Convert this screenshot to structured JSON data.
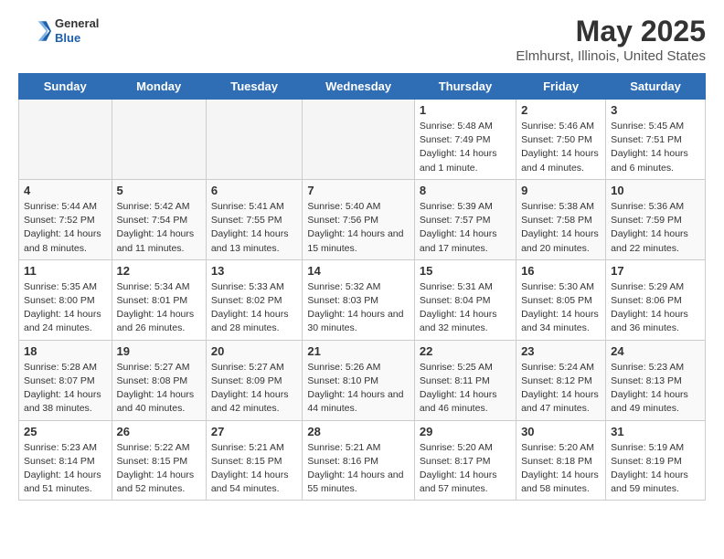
{
  "logo": {
    "general": "General",
    "blue": "Blue"
  },
  "title": "May 2025",
  "subtitle": "Elmhurst, Illinois, United States",
  "days_of_week": [
    "Sunday",
    "Monday",
    "Tuesday",
    "Wednesday",
    "Thursday",
    "Friday",
    "Saturday"
  ],
  "weeks": [
    [
      {
        "day": "",
        "empty": true
      },
      {
        "day": "",
        "empty": true
      },
      {
        "day": "",
        "empty": true
      },
      {
        "day": "",
        "empty": true
      },
      {
        "day": "1",
        "info": "Sunrise: 5:48 AM\nSunset: 7:49 PM\nDaylight: 14 hours\nand 1 minute."
      },
      {
        "day": "2",
        "info": "Sunrise: 5:46 AM\nSunset: 7:50 PM\nDaylight: 14 hours\nand 4 minutes."
      },
      {
        "day": "3",
        "info": "Sunrise: 5:45 AM\nSunset: 7:51 PM\nDaylight: 14 hours\nand 6 minutes."
      }
    ],
    [
      {
        "day": "4",
        "info": "Sunrise: 5:44 AM\nSunset: 7:52 PM\nDaylight: 14 hours\nand 8 minutes."
      },
      {
        "day": "5",
        "info": "Sunrise: 5:42 AM\nSunset: 7:54 PM\nDaylight: 14 hours\nand 11 minutes."
      },
      {
        "day": "6",
        "info": "Sunrise: 5:41 AM\nSunset: 7:55 PM\nDaylight: 14 hours\nand 13 minutes."
      },
      {
        "day": "7",
        "info": "Sunrise: 5:40 AM\nSunset: 7:56 PM\nDaylight: 14 hours\nand 15 minutes."
      },
      {
        "day": "8",
        "info": "Sunrise: 5:39 AM\nSunset: 7:57 PM\nDaylight: 14 hours\nand 17 minutes."
      },
      {
        "day": "9",
        "info": "Sunrise: 5:38 AM\nSunset: 7:58 PM\nDaylight: 14 hours\nand 20 minutes."
      },
      {
        "day": "10",
        "info": "Sunrise: 5:36 AM\nSunset: 7:59 PM\nDaylight: 14 hours\nand 22 minutes."
      }
    ],
    [
      {
        "day": "11",
        "info": "Sunrise: 5:35 AM\nSunset: 8:00 PM\nDaylight: 14 hours\nand 24 minutes."
      },
      {
        "day": "12",
        "info": "Sunrise: 5:34 AM\nSunset: 8:01 PM\nDaylight: 14 hours\nand 26 minutes."
      },
      {
        "day": "13",
        "info": "Sunrise: 5:33 AM\nSunset: 8:02 PM\nDaylight: 14 hours\nand 28 minutes."
      },
      {
        "day": "14",
        "info": "Sunrise: 5:32 AM\nSunset: 8:03 PM\nDaylight: 14 hours\nand 30 minutes."
      },
      {
        "day": "15",
        "info": "Sunrise: 5:31 AM\nSunset: 8:04 PM\nDaylight: 14 hours\nand 32 minutes."
      },
      {
        "day": "16",
        "info": "Sunrise: 5:30 AM\nSunset: 8:05 PM\nDaylight: 14 hours\nand 34 minutes."
      },
      {
        "day": "17",
        "info": "Sunrise: 5:29 AM\nSunset: 8:06 PM\nDaylight: 14 hours\nand 36 minutes."
      }
    ],
    [
      {
        "day": "18",
        "info": "Sunrise: 5:28 AM\nSunset: 8:07 PM\nDaylight: 14 hours\nand 38 minutes."
      },
      {
        "day": "19",
        "info": "Sunrise: 5:27 AM\nSunset: 8:08 PM\nDaylight: 14 hours\nand 40 minutes."
      },
      {
        "day": "20",
        "info": "Sunrise: 5:27 AM\nSunset: 8:09 PM\nDaylight: 14 hours\nand 42 minutes."
      },
      {
        "day": "21",
        "info": "Sunrise: 5:26 AM\nSunset: 8:10 PM\nDaylight: 14 hours\nand 44 minutes."
      },
      {
        "day": "22",
        "info": "Sunrise: 5:25 AM\nSunset: 8:11 PM\nDaylight: 14 hours\nand 46 minutes."
      },
      {
        "day": "23",
        "info": "Sunrise: 5:24 AM\nSunset: 8:12 PM\nDaylight: 14 hours\nand 47 minutes."
      },
      {
        "day": "24",
        "info": "Sunrise: 5:23 AM\nSunset: 8:13 PM\nDaylight: 14 hours\nand 49 minutes."
      }
    ],
    [
      {
        "day": "25",
        "info": "Sunrise: 5:23 AM\nSunset: 8:14 PM\nDaylight: 14 hours\nand 51 minutes."
      },
      {
        "day": "26",
        "info": "Sunrise: 5:22 AM\nSunset: 8:15 PM\nDaylight: 14 hours\nand 52 minutes."
      },
      {
        "day": "27",
        "info": "Sunrise: 5:21 AM\nSunset: 8:15 PM\nDaylight: 14 hours\nand 54 minutes."
      },
      {
        "day": "28",
        "info": "Sunrise: 5:21 AM\nSunset: 8:16 PM\nDaylight: 14 hours\nand 55 minutes."
      },
      {
        "day": "29",
        "info": "Sunrise: 5:20 AM\nSunset: 8:17 PM\nDaylight: 14 hours\nand 57 minutes."
      },
      {
        "day": "30",
        "info": "Sunrise: 5:20 AM\nSunset: 8:18 PM\nDaylight: 14 hours\nand 58 minutes."
      },
      {
        "day": "31",
        "info": "Sunrise: 5:19 AM\nSunset: 8:19 PM\nDaylight: 14 hours\nand 59 minutes."
      }
    ]
  ]
}
